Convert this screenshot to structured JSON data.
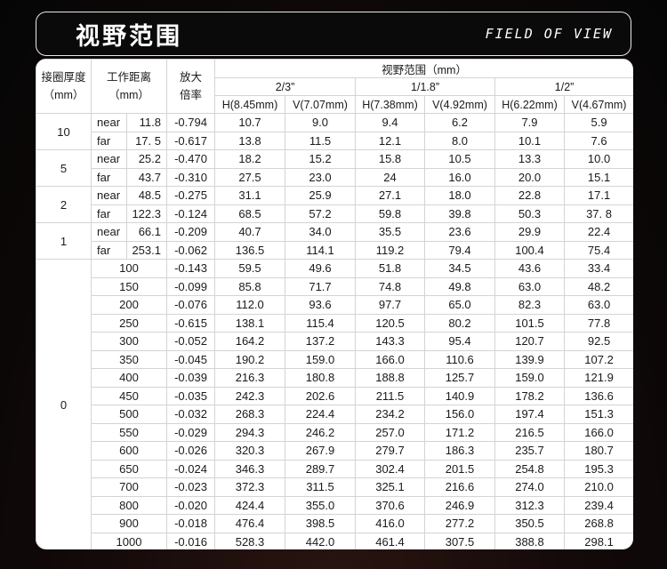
{
  "header": {
    "title": "视野范围",
    "subtitle": "FIELD OF VIEW"
  },
  "table": {
    "col_ext": "接圈厚度（mm）",
    "col_wd": "工作距离（mm）",
    "col_mag": "放大倍率",
    "fov_group": "视野范围（mm）",
    "sensors": [
      "2/3”",
      "1/1.8”",
      "1/2”"
    ],
    "sub_headers": [
      "H(8.45mm)",
      "V(7.07mm)",
      "H(7.38mm)",
      "V(4.92mm)",
      "H(6.22mm)",
      "V(4.67mm)"
    ],
    "groups": [
      {
        "ext": "10",
        "rows": [
          {
            "tag": "near",
            "wd": "11.8",
            "mag": "-0.794",
            "v": [
              "10.7",
              "9.0",
              "9.4",
              "6.2",
              "7.9",
              "5.9"
            ]
          },
          {
            "tag": "far",
            "wd": "17. 5",
            "mag": "-0.617",
            "v": [
              "13.8",
              "11.5",
              "12.1",
              "8.0",
              "10.1",
              "7.6"
            ]
          }
        ]
      },
      {
        "ext": "5",
        "rows": [
          {
            "tag": "near",
            "wd": "25.2",
            "mag": "-0.470",
            "v": [
              "18.2",
              "15.2",
              "15.8",
              "10.5",
              "13.3",
              "10.0"
            ]
          },
          {
            "tag": "far",
            "wd": "43.7",
            "mag": "-0.310",
            "v": [
              "27.5",
              "23.0",
              "24",
              "16.0",
              "20.0",
              "15.1"
            ]
          }
        ]
      },
      {
        "ext": "2",
        "rows": [
          {
            "tag": "near",
            "wd": "48.5",
            "mag": "-0.275",
            "v": [
              "31.1",
              "25.9",
              "27.1",
              "18.0",
              "22.8",
              "17.1"
            ]
          },
          {
            "tag": "far",
            "wd": "122.3",
            "mag": "-0.124",
            "v": [
              "68.5",
              "57.2",
              "59.8",
              "39.8",
              "50.3",
              "37. 8"
            ]
          }
        ]
      },
      {
        "ext": "1",
        "rows": [
          {
            "tag": "near",
            "wd": "66.1",
            "mag": "-0.209",
            "v": [
              "40.7",
              "34.0",
              "35.5",
              "23.6",
              "29.9",
              "22.4"
            ]
          },
          {
            "tag": "far",
            "wd": "253.1",
            "mag": "-0.062",
            "v": [
              "136.5",
              "114.1",
              "119.2",
              "79.4",
              "100.4",
              "75.4"
            ]
          }
        ]
      },
      {
        "ext": "0",
        "rows": [
          {
            "wd": "100",
            "mag": "-0.143",
            "v": [
              "59.5",
              "49.6",
              "51.8",
              "34.5",
              "43.6",
              "33.4"
            ]
          },
          {
            "wd": "150",
            "mag": "-0.099",
            "v": [
              "85.8",
              "71.7",
              "74.8",
              "49.8",
              "63.0",
              "48.2"
            ]
          },
          {
            "wd": "200",
            "mag": "-0.076",
            "v": [
              "112.0",
              "93.6",
              "97.7",
              "65.0",
              "82.3",
              "63.0"
            ]
          },
          {
            "wd": "250",
            "mag": "-0.615",
            "v": [
              "138.1",
              "115.4",
              "120.5",
              "80.2",
              "101.5",
              "77.8"
            ]
          },
          {
            "wd": "300",
            "mag": "-0.052",
            "v": [
              "164.2",
              "137.2",
              "143.3",
              "95.4",
              "120.7",
              "92.5"
            ]
          },
          {
            "wd": "350",
            "mag": "-0.045",
            "v": [
              "190.2",
              "159.0",
              "166.0",
              "110.6",
              "139.9",
              "107.2"
            ]
          },
          {
            "wd": "400",
            "mag": "-0.039",
            "v": [
              "216.3",
              "180.8",
              "188.8",
              "125.7",
              "159.0",
              "121.9"
            ]
          },
          {
            "wd": "450",
            "mag": "-0.035",
            "v": [
              "242.3",
              "202.6",
              "211.5",
              "140.9",
              "178.2",
              "136.6"
            ]
          },
          {
            "wd": "500",
            "mag": "-0.032",
            "v": [
              "268.3",
              "224.4",
              "234.2",
              "156.0",
              "197.4",
              "151.3"
            ]
          },
          {
            "wd": "550",
            "mag": "-0.029",
            "v": [
              "294.3",
              "246.2",
              "257.0",
              "171.2",
              "216.5",
              "166.0"
            ]
          },
          {
            "wd": "600",
            "mag": "-0.026",
            "v": [
              "320.3",
              "267.9",
              "279.7",
              "186.3",
              "235.7",
              "180.7"
            ]
          },
          {
            "wd": "650",
            "mag": "-0.024",
            "v": [
              "346.3",
              "289.7",
              "302.4",
              "201.5",
              "254.8",
              "195.3"
            ]
          },
          {
            "wd": "700",
            "mag": "-0.023",
            "v": [
              "372.3",
              "311.5",
              "325.1",
              "216.6",
              "274.0",
              "210.0"
            ]
          },
          {
            "wd": "800",
            "mag": "-0.020",
            "v": [
              "424.4",
              "355.0",
              "370.6",
              "246.9",
              "312.3",
              "239.4"
            ]
          },
          {
            "wd": "900",
            "mag": "-0.018",
            "v": [
              "476.4",
              "398.5",
              "416.0",
              "277.2",
              "350.5",
              "268.8"
            ]
          },
          {
            "wd": "1000",
            "mag": "-0.016",
            "v": [
              "528.3",
              "442.0",
              "461.4",
              "307.5",
              "388.8",
              "298.1"
            ]
          }
        ]
      }
    ]
  }
}
